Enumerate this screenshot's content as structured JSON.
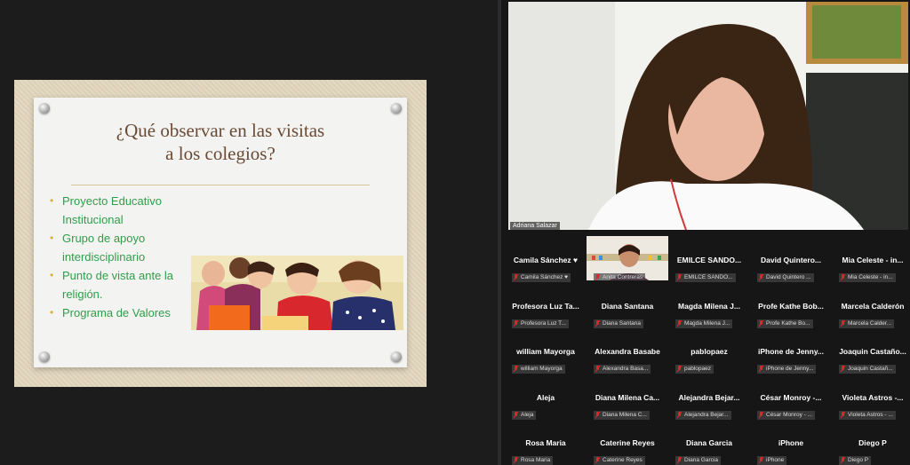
{
  "slide": {
    "title_line1": "¿Qué observar en las visitas",
    "title_line2": "a los colegios?",
    "bullets": [
      "Proyecto Educativo Institucional",
      "Grupo de apoyo interdisciplinario",
      "Punto de vista ante la religión.",
      "Programa de Valores"
    ]
  },
  "speaker": {
    "name": "Adriana Salazar"
  },
  "participants": [
    {
      "name": "Camila Sánchez ♥",
      "label": "Camila Sánchez ♥"
    },
    {
      "name": "",
      "label": "Anita Contreras"
    },
    {
      "name": "EMILCE SANDO...",
      "label": "EMILCE SANDO..."
    },
    {
      "name": "David Quintero...",
      "label": "David Quintero ..."
    },
    {
      "name": "Mia Celeste - in...",
      "label": "Mia Celeste - in..."
    },
    {
      "name": "Profesora Luz Ta...",
      "label": "Profesora Luz T..."
    },
    {
      "name": "Diana Santana",
      "label": "Diana Santana"
    },
    {
      "name": "Magda Milena J...",
      "label": "Magda Milena J..."
    },
    {
      "name": "Profe Kathe Bob...",
      "label": "Profe Kathe Bo..."
    },
    {
      "name": "Marcela Calderón",
      "label": "Marcela Calder..."
    },
    {
      "name": "william Mayorga",
      "label": "william Mayorga"
    },
    {
      "name": "Alexandra Basabe",
      "label": "Alexandra Basa..."
    },
    {
      "name": "pablopaez",
      "label": "pablopaez"
    },
    {
      "name": "iPhone de Jenny...",
      "label": "iPhone de Jenny..."
    },
    {
      "name": "Joaquin Castaño...",
      "label": "Joaquin Castañ..."
    },
    {
      "name": "Aleja",
      "label": "Aleja"
    },
    {
      "name": "Diana Milena Ca...",
      "label": "Diana Milena C..."
    },
    {
      "name": "Alejandra Bejar...",
      "label": "Alejandra Bejar..."
    },
    {
      "name": "César Monroy -...",
      "label": "César Monroy - ..."
    },
    {
      "name": "Violeta Astros -...",
      "label": "Violeta Astros - ..."
    },
    {
      "name": "Rosa Maria",
      "label": "Rosa Maria"
    },
    {
      "name": "Caterine Reyes",
      "label": "Caterine Reyes"
    },
    {
      "name": "Diana Garcia",
      "label": "Diana Garcia"
    },
    {
      "name": "iPhone",
      "label": "iPhone"
    },
    {
      "name": "Diego P",
      "label": "Diego P"
    }
  ],
  "colors": {
    "bullet_text": "#2f9e4a",
    "title_text": "#6a4a34",
    "muted_mic": "#e0262b"
  }
}
